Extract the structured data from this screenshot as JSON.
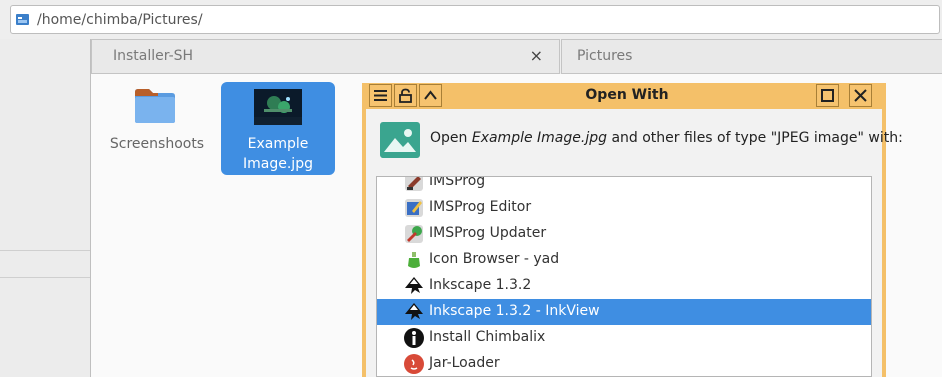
{
  "address_bar": {
    "path": "/home/chimba/Pictures/"
  },
  "tabs": [
    {
      "label": "Installer-SH",
      "close_glyph": "×"
    },
    {
      "label": "Pictures"
    }
  ],
  "files": [
    {
      "name": "Screenshoots",
      "icon": "folder-icon"
    },
    {
      "name_line1": "Example",
      "name_line2": "Image.jpg",
      "icon": "image-thumbnail"
    }
  ],
  "dialog": {
    "title": "Open With",
    "prompt_before": "Open ",
    "prompt_filename": "Example Image.jpg",
    "prompt_after": " and other files of type \"JPEG image\" with:",
    "accent_color": "#f4c069",
    "selection_color": "#3f8ee2"
  },
  "apps": [
    {
      "label": "IMSProg",
      "icon": "imsprog-icon"
    },
    {
      "label": "IMSProg Editor",
      "icon": "imsprog-editor-icon"
    },
    {
      "label": "IMSProg Updater",
      "icon": "imsprog-updater-icon"
    },
    {
      "label": "Icon Browser - yad",
      "icon": "icon-browser-icon"
    },
    {
      "label": "Inkscape 1.3.2",
      "icon": "inkscape-icon"
    },
    {
      "label": "Inkscape 1.3.2 - InkView",
      "icon": "inkview-icon",
      "selected": true
    },
    {
      "label": "Install Chimbalix",
      "icon": "info-icon"
    },
    {
      "label": "Jar-Loader",
      "icon": "java-icon"
    }
  ]
}
